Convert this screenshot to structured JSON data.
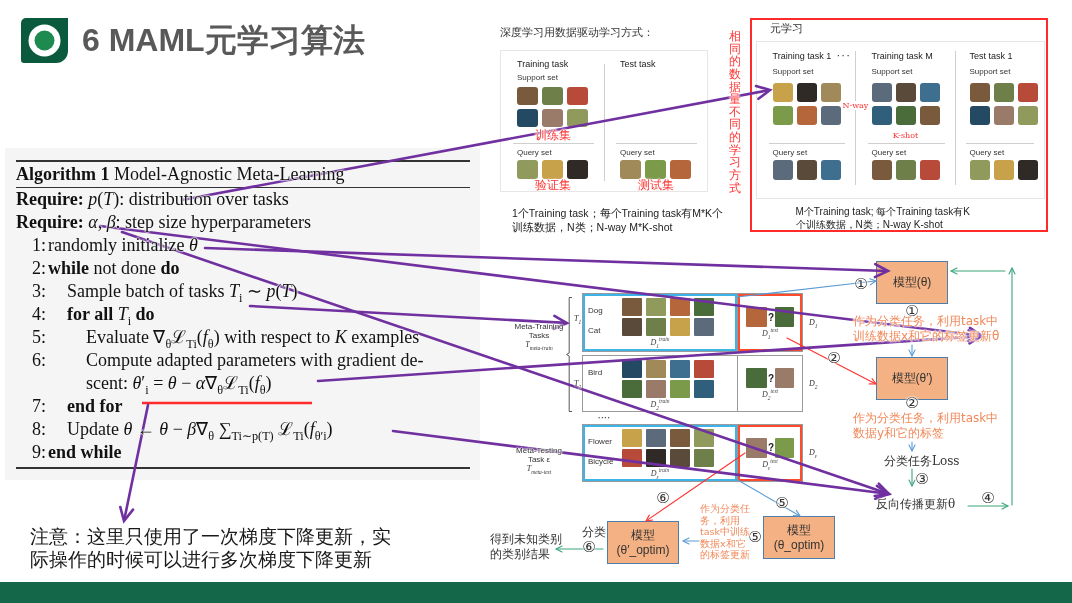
{
  "header": {
    "title": "6 MAML元学习算法"
  },
  "algorithm": {
    "heading": "**Algorithm 1** Model-Agnostic Meta-Learning",
    "requires": [
      "**Require:** *p*(*T*): distribution over tasks",
      "**Require:** *α*, *β*: step size hyperparameters"
    ],
    "lines": [
      {
        "number": "1:",
        "kind": "statement",
        "text": "randomly initialize *θ*"
      },
      {
        "number": "2:",
        "kind": "statement",
        "text": "**while** not done **do**",
        "children": [
          {
            "number": "3:",
            "kind": "statement",
            "text": "Sample batch of tasks *T*$_{i}$ ∼ *p*(*T*)"
          },
          {
            "number": "4:",
            "kind": "statement",
            "text": "**for all** *T*$_{i}$ **do**",
            "children": [
              {
                "number": "5:",
                "kind": "statement",
                "text": "Evaluate ∇$_{θ}$ℒ$_{Ti}$(*f*$_{θ}$) with respect to *K* examples"
              },
              {
                "number": "6:",
                "kind": "statement",
                "text": "Compute adapted parameters with gradient de-\nscent: *θ*′$_{i}$ = *θ* − *α*∇$_{θ}$ℒ$_{Ti}$(*f*$_{θ}$)"
              }
            ]
          },
          {
            "number": "7:",
            "kind": "keyword",
            "text": "end for"
          },
          {
            "number": "8:",
            "kind": "statement",
            "text": "Update *θ* ← *θ* − *β*∇$_{θ}$ ∑$_{Ti∼p(T)}$ ℒ$_{Ti}$(*f*$_{θ′i}$)"
          }
        ]
      },
      {
        "number": "9:",
        "kind": "keyword",
        "text": "end while"
      }
    ]
  },
  "note": "注意：这里只使用了一次梯度下降更新，实际操作的时候可以进行多次梯度下降更新",
  "data_driven_panel": {
    "caption": "深度学习用数据驱动学习方式：",
    "columns": [
      {
        "title": "Training task",
        "support_label": "Support set",
        "support_tag": "训练集",
        "query_label": "Query set",
        "query_tag": "验证集"
      },
      {
        "title": "Test task",
        "query_label": "Query set",
        "query_tag": "测试集"
      }
    ],
    "summary_lines": [
      "1个Training task；每个Training task有M*K个",
      "训练数据，N类；N-way M*K-shot"
    ]
  },
  "side_note": "相同的数据量不同的学习方式",
  "meta_panel": {
    "title": "元学习",
    "columns": [
      {
        "title": "Training task 1",
        "support_label": "Support set",
        "query_label": "Query set"
      },
      {
        "title": "Training task M",
        "support_label": "Support set",
        "support_tag": "K-shot",
        "query_label": "Query set"
      },
      {
        "title": "Test task 1",
        "support_label": "Support set",
        "query_label": "Query set"
      }
    ],
    "ellipsis": "· · ·",
    "side_tag": "N-way",
    "summary_lines": [
      "M个Training task; 每个Training task有K",
      "个训练数据，N类；N-way K-shot"
    ]
  },
  "task_figure": {
    "groups": [
      {
        "title": "Meta-Training Tasks",
        "symbol": "T$_{meta-train}$"
      },
      {
        "title": "Meta-Testing Task ε",
        "symbol": "T$_{meta-test}$"
      }
    ],
    "rows": [
      {
        "task": "T$_{1}$",
        "classes": [
          "Dog",
          "Cat"
        ],
        "train_set": "D$_{1}$$^{train}$",
        "query_mark": "?",
        "test_set": "D$_{1}$$^{test}$",
        "dataset": "D$_{1}$",
        "highlighted": true
      },
      {
        "task": "T$_{2}$",
        "classes": [
          "Bird"
        ],
        "train_set": "D$_{2}$$^{train}$",
        "query_mark": "?",
        "test_set": "D$_{2}$$^{test}$",
        "dataset": "D$_{2}$",
        "highlighted": false
      },
      {
        "classes": [
          "Flower",
          "Bicycle"
        ],
        "train_set": "D$_{ε}$$^{train}$",
        "query_mark": "?",
        "test_set": "D$_{ε}$$^{test}$",
        "dataset": "D$_{ε}$",
        "highlighted": true
      }
    ],
    "ellipsis": "····"
  },
  "maml_flow": {
    "models": [
      "模型(θ)",
      "模型(θ′)",
      "模型(θ′_optim)",
      "模型(θ_optim)"
    ],
    "step_marks": [
      "①",
      "①",
      "②",
      "②",
      "③",
      "⑥",
      "⑤",
      "④",
      "⑥",
      "⑤"
    ],
    "notes": [
      {
        "kind": "orange",
        "text": "作为分类任务，利用task中训练数据x和它的标签更新θ"
      },
      {
        "kind": "orange",
        "text": "作为分类任务，利用task中数据y和它的标签"
      },
      {
        "kind": "plain",
        "text": "分类任务Loss"
      },
      {
        "kind": "plain",
        "text": "反向传播更新θ"
      },
      {
        "kind": "plain",
        "text": "得到未知类别的类别结果"
      },
      {
        "kind": "plain",
        "text": "分类"
      },
      {
        "kind": "orange",
        "lines": [
          "作为分类任",
          "务，利用",
          "task中训练",
          "数据x和它",
          "的标签更新"
        ]
      }
    ]
  }
}
